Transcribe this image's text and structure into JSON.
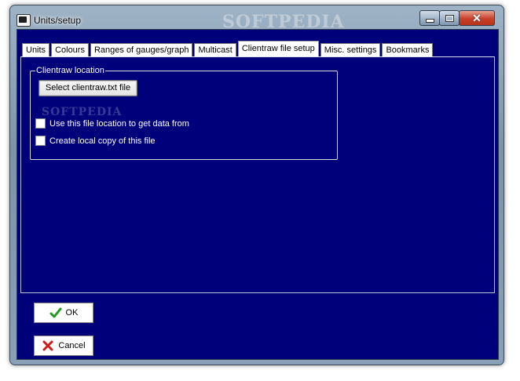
{
  "window": {
    "title": "Units/setup",
    "watermark_title": "SOFTPEDIA",
    "controls": {
      "minimize": "minimize",
      "maximize": "maximize",
      "close": "close"
    }
  },
  "tabs": [
    {
      "label": "Units"
    },
    {
      "label": "Colours"
    },
    {
      "label": "Ranges of gauges/graph"
    },
    {
      "label": "Multicast"
    },
    {
      "label": "Clientraw file setup",
      "active": true
    },
    {
      "label": "Misc. settings"
    },
    {
      "label": "Bookmarks"
    }
  ],
  "clientraw": {
    "group_title": "Clientraw location",
    "select_button": "Select clientraw.txt file",
    "watermark": "SOFTPEDIA",
    "use_location_label": "Use this file location to get data from",
    "use_location_checked": false,
    "local_copy_label": "Create local copy of this file",
    "local_copy_checked": false
  },
  "buttons": {
    "ok_label": "OK",
    "cancel_label": "Cancel"
  },
  "colors": {
    "client_background": "#00007a",
    "ok_icon": "#1f9a1f",
    "cancel_icon": "#d11b1b"
  },
  "icons": {
    "app": "app-window-icon",
    "ok": "check-icon",
    "cancel": "x-icon"
  }
}
